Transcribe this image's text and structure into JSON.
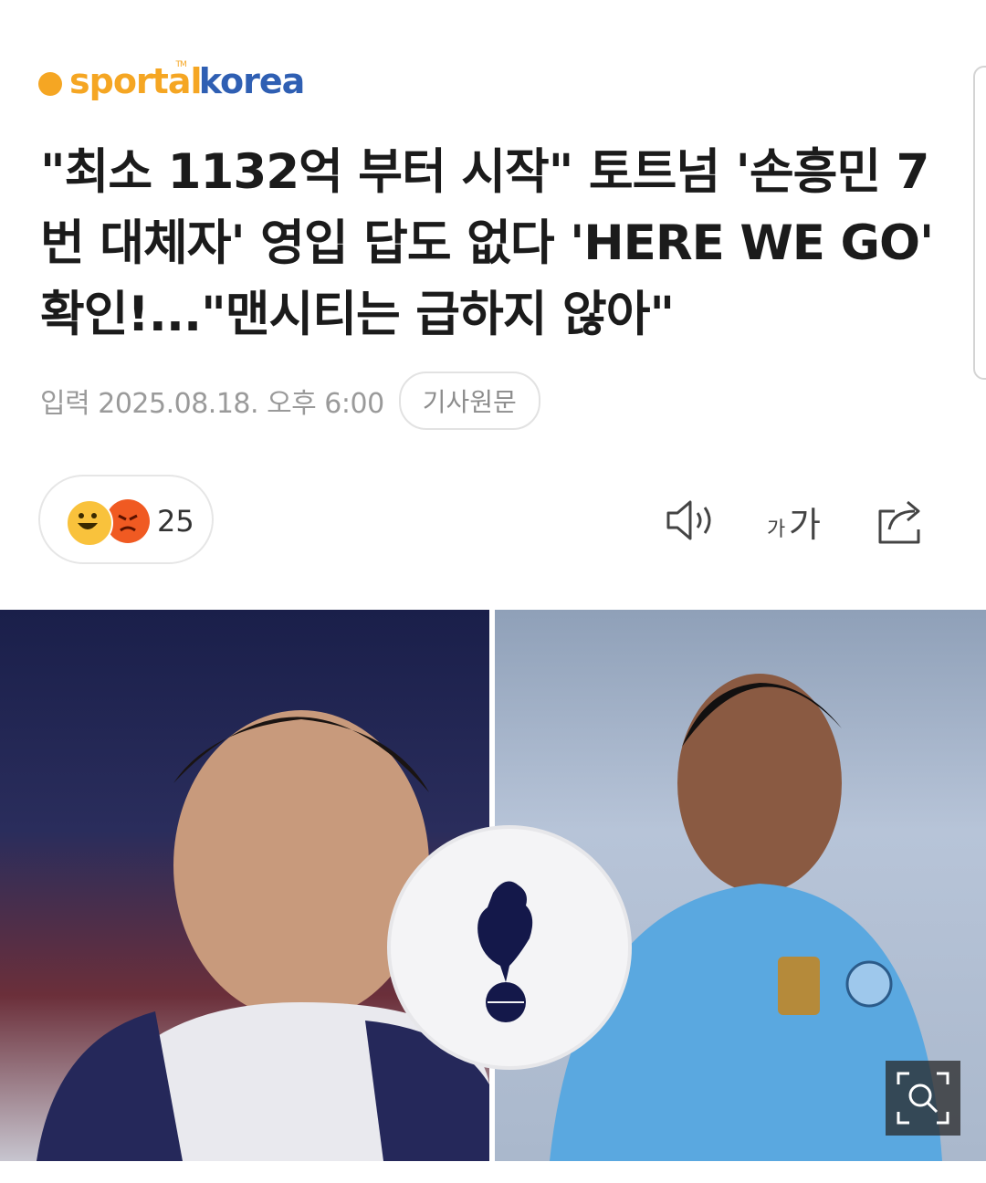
{
  "brand": {
    "logo_left": "sport",
    "logo_mid": "al",
    "logo_right": "korea",
    "logo_tm": "TM",
    "orange": "#f5a623",
    "blue": "#2f5fb3"
  },
  "article": {
    "title": "\"최소 1132억 부터 시작\" 토트넘 '손흥민 7번 대체자' 영입 답도 없다 'HERE WE GO' 확인!...\"맨시티는 급하지 않아\"",
    "date": "입력 2025.08.18. 오후 6:00",
    "source_button": "기사원문"
  },
  "reactions": {
    "count": "25",
    "icons": [
      "happy-emoji-icon",
      "angry-emoji-icon"
    ]
  },
  "toolbar": {
    "icons": [
      "speaker-icon",
      "font-size-icon",
      "share-icon"
    ],
    "font_small": "가",
    "font_big": "가"
  },
  "image": {
    "icons": [
      "tottenham-crest-icon",
      "zoom-icon"
    ]
  }
}
